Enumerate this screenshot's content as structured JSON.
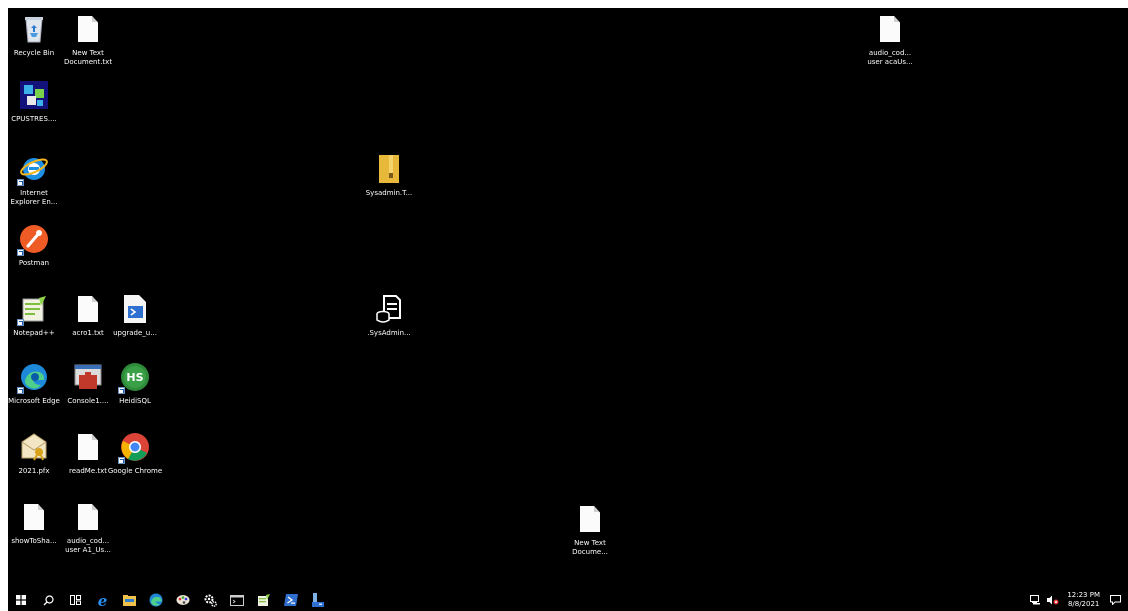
{
  "desktop": {
    "icons": {
      "recycle_bin": "Recycle Bin",
      "new_text_document_txt": "New Text Document.txt",
      "audio_cod_top": "audio_cod... user acaUs...",
      "cpustres": "CPUSTRES....",
      "internet_explorer": "Internet Explorer En...",
      "sysadmin_t": "Sysadmin.T...",
      "postman": "Postman",
      "notepadpp": "Notepad++",
      "acro1": "acro1.txt",
      "upgrade_u": "upgrade_u...",
      "sysadmin_db": ".SysAdmin...",
      "microsoft_edge": "Microsoft Edge",
      "console1": "Console1....",
      "heidisql": "HeidiSQL",
      "pfx_2021": "2021.pfx",
      "readme": "readMe.txt",
      "google_chrome": "Google Chrome",
      "showtosha": "showToSha...",
      "audio_cod_bottom": "audio_cod... user A1_Us...",
      "new_text_docume": "New Text Docume..."
    }
  },
  "taskbar": {
    "time": "12:23 PM",
    "date": "8/8/2021"
  },
  "colors": {
    "desktop_bg": "#000000",
    "folder": "#e8b83a",
    "edge": "#1e88d9",
    "chrome_red": "#db4437",
    "postman": "#ef5b25"
  }
}
